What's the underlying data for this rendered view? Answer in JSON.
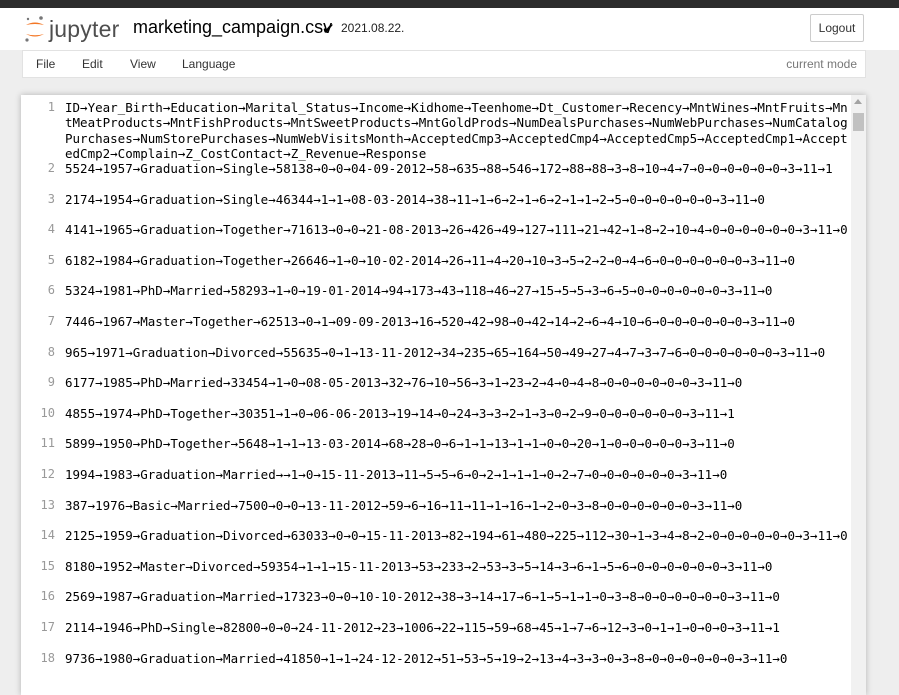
{
  "header": {
    "logo_text": "jupyter",
    "filename": "marketing_campaign.csv",
    "save_status": "2021.08.22.",
    "logout_label": "Logout"
  },
  "menubar": {
    "items": [
      "File",
      "Edit",
      "View",
      "Language"
    ],
    "mode": "current mode"
  },
  "editor": {
    "lines": [
      {
        "n": "1",
        "text": "ID→Year_Birth→Education→Marital_Status→Income→Kidhome→Teenhome→Dt_Customer→Recency→MntWines→MntFruits→MntMeatProducts→MntFishProducts→MntSweetProducts→MntGoldProds→NumDealsPurchases→NumWebPurchases→NumCatalogPurchases→NumStorePurchases→NumWebVisitsMonth→AcceptedCmp3→AcceptedCmp4→AcceptedCmp5→AcceptedCmp1→AcceptedCmp2→Complain→Z_CostContact→Z_Revenue→Response"
      },
      {
        "n": "2",
        "text": "5524→1957→Graduation→Single→58138→0→0→04-09-2012→58→635→88→546→172→88→88→3→8→10→4→7→0→0→0→0→0→0→3→11→1"
      },
      {
        "n": "3",
        "text": "2174→1954→Graduation→Single→46344→1→1→08-03-2014→38→11→1→6→2→1→6→2→1→1→2→5→0→0→0→0→0→0→3→11→0"
      },
      {
        "n": "4",
        "text": "4141→1965→Graduation→Together→71613→0→0→21-08-2013→26→426→49→127→111→21→42→1→8→2→10→4→0→0→0→0→0→0→3→11→0"
      },
      {
        "n": "5",
        "text": "6182→1984→Graduation→Together→26646→1→0→10-02-2014→26→11→4→20→10→3→5→2→2→0→4→6→0→0→0→0→0→0→3→11→0"
      },
      {
        "n": "6",
        "text": "5324→1981→PhD→Married→58293→1→0→19-01-2014→94→173→43→118→46→27→15→5→5→3→6→5→0→0→0→0→0→0→3→11→0"
      },
      {
        "n": "7",
        "text": "7446→1967→Master→Together→62513→0→1→09-09-2013→16→520→42→98→0→42→14→2→6→4→10→6→0→0→0→0→0→0→3→11→0"
      },
      {
        "n": "8",
        "text": "965→1971→Graduation→Divorced→55635→0→1→13-11-2012→34→235→65→164→50→49→27→4→7→3→7→6→0→0→0→0→0→0→3→11→0"
      },
      {
        "n": "9",
        "text": "6177→1985→PhD→Married→33454→1→0→08-05-2013→32→76→10→56→3→1→23→2→4→0→4→8→0→0→0→0→0→0→3→11→0"
      },
      {
        "n": "10",
        "text": "4855→1974→PhD→Together→30351→1→0→06-06-2013→19→14→0→24→3→3→2→1→3→0→2→9→0→0→0→0→0→0→3→11→1"
      },
      {
        "n": "11",
        "text": "5899→1950→PhD→Together→5648→1→1→13-03-2014→68→28→0→6→1→1→13→1→1→0→0→20→1→0→0→0→0→0→3→11→0"
      },
      {
        "n": "12",
        "text": "1994→1983→Graduation→Married→→1→0→15-11-2013→11→5→5→6→0→2→1→1→1→0→2→7→0→0→0→0→0→0→3→11→0"
      },
      {
        "n": "13",
        "text": "387→1976→Basic→Married→7500→0→0→13-11-2012→59→6→16→11→11→1→16→1→2→0→3→8→0→0→0→0→0→0→3→11→0"
      },
      {
        "n": "14",
        "text": "2125→1959→Graduation→Divorced→63033→0→0→15-11-2013→82→194→61→480→225→112→30→1→3→4→8→2→0→0→0→0→0→0→3→11→0"
      },
      {
        "n": "15",
        "text": "8180→1952→Master→Divorced→59354→1→1→15-11-2013→53→233→2→53→3→5→14→3→6→1→5→6→0→0→0→0→0→0→3→11→0"
      },
      {
        "n": "16",
        "text": "2569→1987→Graduation→Married→17323→0→0→10-10-2012→38→3→14→17→6→1→5→1→1→0→3→8→0→0→0→0→0→0→3→11→0"
      },
      {
        "n": "17",
        "text": "2114→1946→PhD→Single→82800→0→0→24-11-2012→23→1006→22→115→59→68→45→1→7→6→12→3→0→1→1→0→0→0→3→11→1"
      },
      {
        "n": "18",
        "text": "9736→1980→Graduation→Married→41850→1→1→24-12-2012→51→53→5→19→2→13→4→3→3→0→3→8→0→0→0→0→0→0→3→11→0"
      }
    ]
  }
}
